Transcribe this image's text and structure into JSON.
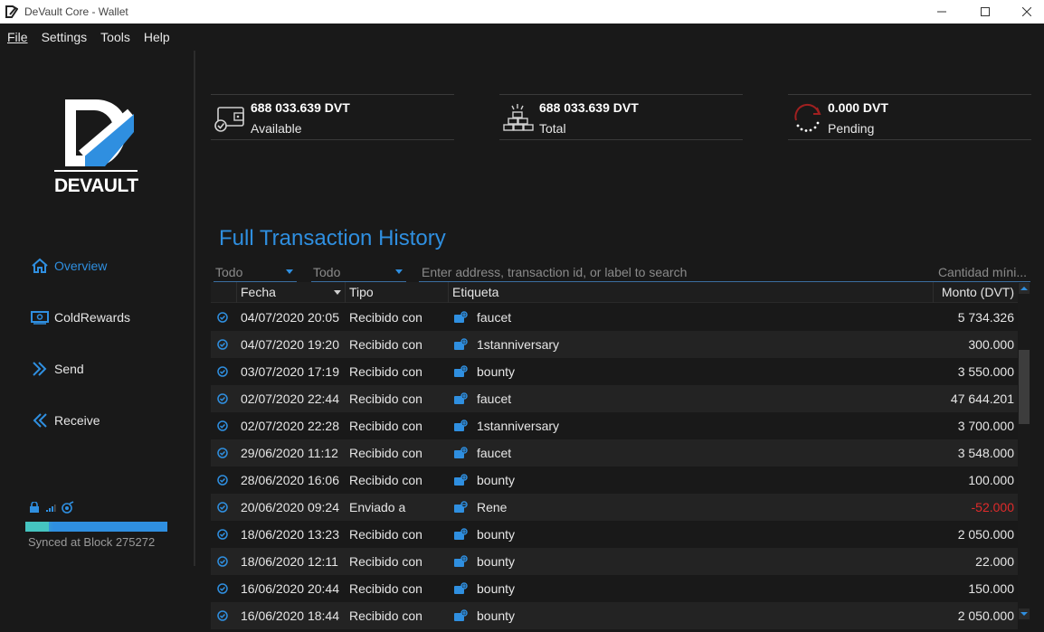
{
  "window": {
    "title": "DeVault Core - Wallet"
  },
  "menu": {
    "file": "File",
    "settings": "Settings",
    "tools": "Tools",
    "help": "Help"
  },
  "brand": {
    "logo_text": "DEVAULT"
  },
  "nav": {
    "overview": "Overview",
    "coldrewards": "ColdRewards",
    "send": "Send",
    "receive": "Receive"
  },
  "status": {
    "sync_text": "Synced at Block 275272",
    "sync_progress": 1.0
  },
  "balances": {
    "available": {
      "amount": "688 033.639 DVT",
      "label": "Available"
    },
    "total": {
      "amount": "688 033.639 DVT",
      "label": "Total"
    },
    "pending": {
      "amount": "0.000 DVT",
      "label": "Pending"
    }
  },
  "page_title": "Full Transaction History",
  "filters": {
    "date": "Todo",
    "type": "Todo",
    "search_placeholder": "Enter address, transaction id, or label to search",
    "min_amount_placeholder": "Cantidad míni..."
  },
  "table": {
    "headers": {
      "date": "Fecha",
      "type": "Tipo",
      "label": "Etiqueta",
      "amount": "Monto (DVT)"
    },
    "rows": [
      {
        "date": "04/07/2020 20:05",
        "type": "Recibido con",
        "label": "faucet",
        "amount": "5 734.326"
      },
      {
        "date": "04/07/2020 19:20",
        "type": "Recibido con",
        "label": "1stanniversary",
        "amount": "300.000"
      },
      {
        "date": "03/07/2020 17:19",
        "type": "Recibido con",
        "label": "bounty",
        "amount": "3 550.000"
      },
      {
        "date": "02/07/2020 22:44",
        "type": "Recibido con",
        "label": "faucet",
        "amount": "47 644.201"
      },
      {
        "date": "02/07/2020 22:28",
        "type": "Recibido con",
        "label": "1stanniversary",
        "amount": "3 700.000"
      },
      {
        "date": "29/06/2020 11:12",
        "type": "Recibido con",
        "label": "faucet",
        "amount": "3 548.000"
      },
      {
        "date": "28/06/2020 16:06",
        "type": "Recibido con",
        "label": "bounty",
        "amount": "100.000"
      },
      {
        "date": "20/06/2020 09:24",
        "type": "Enviado a",
        "label": "Rene",
        "amount": "-52.000"
      },
      {
        "date": "18/06/2020 13:23",
        "type": "Recibido con",
        "label": "bounty",
        "amount": "2 050.000"
      },
      {
        "date": "18/06/2020 12:11",
        "type": "Recibido con",
        "label": "bounty",
        "amount": "22.000"
      },
      {
        "date": "16/06/2020 20:44",
        "type": "Recibido con",
        "label": "bounty",
        "amount": "150.000"
      },
      {
        "date": "16/06/2020 18:44",
        "type": "Recibido con",
        "label": "bounty",
        "amount": "2 050.000"
      }
    ]
  },
  "colors": {
    "accent": "#2f8fe0",
    "negative": "#e02b2b",
    "background": "#191919",
    "sync_start": "#45c4c0"
  }
}
